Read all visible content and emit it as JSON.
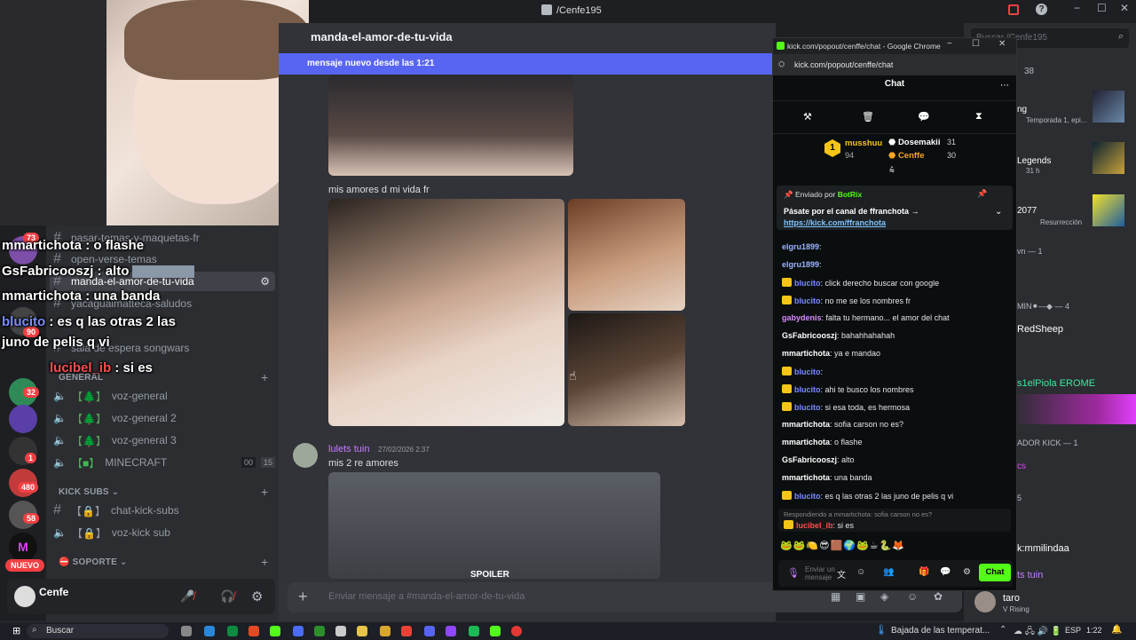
{
  "titlebar": {
    "title": "/Cenfe195",
    "search_placeholder": "Buscar /Cenfe195"
  },
  "channel_header": {
    "name": "manda-el-amor-de-tu-vida",
    "new_messages_bar": "mensaje nuevo desde las 1:21"
  },
  "channels": {
    "items": [
      {
        "name": "pasar-temas-y-maquetas-fr"
      },
      {
        "name": "open-verse-temas"
      },
      {
        "name": "manda-el-amor-de-tu-vida"
      },
      {
        "name": "yacaguaimatteca-saludos"
      },
      {
        "name": "sala de espera songwars"
      }
    ],
    "categories": [
      "GENERAL",
      "KICK SUBS",
      "SOPORTE"
    ],
    "voice": [
      {
        "name": "voz-general"
      },
      {
        "name": "voz-general 2"
      },
      {
        "name": "voz-general 3"
      },
      {
        "name": "MINECRAFT",
        "left": "00",
        "right": "15"
      }
    ],
    "kick_subs": [
      {
        "name": "chat-kick-subs"
      },
      {
        "name": "voz-kick sub"
      }
    ],
    "user": {
      "name": "Cenfe"
    }
  },
  "servers": {
    "badges": [
      "73",
      "90",
      "32",
      "1",
      "480",
      "58"
    ],
    "new_label": "NUEVO"
  },
  "overlay_chat": [
    {
      "user": "mmartichota",
      "text": " : o flashe"
    },
    {
      "user": "GsFabricooszj",
      "text": " : alto"
    },
    {
      "user": "mmartichota",
      "text": " : una banda"
    },
    {
      "user": "blucito",
      "text": " : es q las otras 2 las"
    },
    {
      "user": "",
      "text": "juno de pelis q vi"
    },
    {
      "user": "lucibel_ib",
      "text": " : si es"
    }
  ],
  "messages": [
    {
      "text": "mis amores d mi vida fr"
    },
    {
      "author": "lulets tuin",
      "time": "27/02/2026 2:37",
      "text": "mis 2 re amores",
      "spoiler": "SPOILER"
    }
  ],
  "composer": {
    "placeholder": "Enviar mensaje a #manda-el-amor-de-tu-vida"
  },
  "kick": {
    "window_title": "kick.com/popout/cenffe/chat - Google Chrome",
    "url": "kick.com/popout/cenffe/chat",
    "header": "Chat",
    "leaderboard": [
      {
        "name": "musshuu",
        "value": "94"
      },
      {
        "name": "Dosemakii",
        "value": "31"
      },
      {
        "name": "Cenffe",
        "value": "30"
      }
    ],
    "rank_badge": "1",
    "pinned": {
      "sent_by": "Enviado por",
      "bot": "BotRix",
      "text": "Pásate por el canal de ffranchota →",
      "link": "https://kick.com/ffranchota"
    },
    "lines": [
      {
        "user": "elgru1899",
        "text": ":",
        "color": "#9ab4ff",
        "crown": false
      },
      {
        "user": "elgru1899",
        "text": ":",
        "color": "#9ab4ff",
        "crown": false
      },
      {
        "user": "blucito",
        "text": ": click derecho buscar con google",
        "color": "#7b8cff",
        "crown": true
      },
      {
        "user": "blucito",
        "text": ": no me se los nombres fr",
        "color": "#7b8cff",
        "crown": true
      },
      {
        "user": "gabydenis",
        "text": ": falta tu hermano... el amor del chat",
        "color": "#d88cff",
        "crown": false
      },
      {
        "user": "GsFabricooszj",
        "text": ": bahahhahahah",
        "color": "#ffffff",
        "crown": false
      },
      {
        "user": "mmartichota",
        "text": ": ya e mandao",
        "color": "#ffffff",
        "crown": false
      },
      {
        "user": "blucito",
        "text": ":",
        "color": "#7b8cff",
        "crown": true
      },
      {
        "user": "blucito",
        "text": ": ahi te busco los nombres",
        "color": "#7b8cff",
        "crown": true
      },
      {
        "user": "blucito",
        "text": ": si esa toda, es hermosa",
        "color": "#7b8cff",
        "crown": true
      },
      {
        "user": "mmartichota",
        "text": ": sofia carson no es?",
        "color": "#ffffff",
        "crown": false
      },
      {
        "user": "mmartichota",
        "text": ": o flashe",
        "color": "#ffffff",
        "crown": false
      },
      {
        "user": "GsFabricooszj",
        "text": ": alto",
        "color": "#ffffff",
        "crown": false
      },
      {
        "user": "mmartichota",
        "text": ": una banda",
        "color": "#ffffff",
        "crown": false
      },
      {
        "user": "blucito",
        "text": ": es q las otras 2 las juno de pelis q vi",
        "color": "#7b8cff",
        "crown": true
      }
    ],
    "reply_hint": "Respondiendo a mmartichota: sofia carson no es?",
    "last": {
      "user": "lucibel_ib",
      "text": ": si es"
    },
    "input_placeholder": "Enviar un mensaje",
    "send_label": "Chat"
  },
  "members": {
    "rows": [
      {
        "text": "38"
      },
      {
        "text": "ng"
      },
      {
        "text": "Temporada 1, epi..."
      },
      {
        "text": "Legends"
      },
      {
        "text": "31 h"
      },
      {
        "text": "2077"
      },
      {
        "text": "Resurrección"
      },
      {
        "text": "vn — 1"
      },
      {
        "text": "MIN⚫—◆ — 4"
      },
      {
        "text": "RedSheep"
      },
      {
        "text": "s1elPiola EROME"
      },
      {
        "text": "ADOR KICK — 1"
      },
      {
        "text": "cs"
      },
      {
        "text": "5"
      },
      {
        "text": "k:mmilindaa"
      },
      {
        "text": "ts tuin"
      },
      {
        "text": "taro"
      },
      {
        "text": "V Rising"
      }
    ]
  },
  "taskbar": {
    "search": "Buscar",
    "weather": "Bajada de las temperat...",
    "lang": "ESP",
    "time": "1:22"
  },
  "colors": {
    "accent": "#5865f2",
    "kick_green": "#53fc18",
    "overlay_user": "#ff4d4d"
  }
}
